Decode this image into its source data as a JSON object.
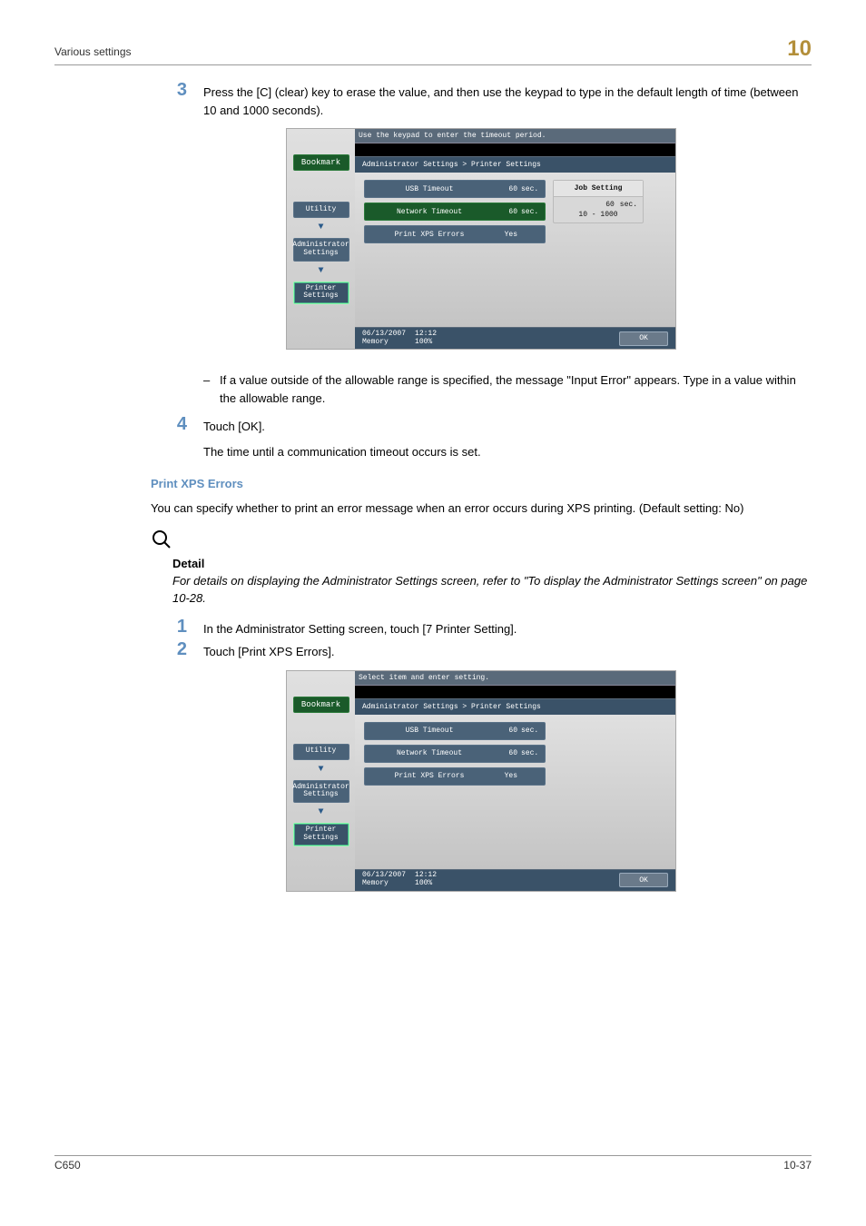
{
  "header": {
    "title": "Various settings",
    "chapter": "10"
  },
  "step3": {
    "num": "3",
    "text": "Press the [C] (clear) key to erase the value, and then use the keypad to type in the default length of time (between 10 and 1000 seconds).",
    "bullet": "If a value outside of the allowable range is specified, the message \"Input Error\" appears. Type in a value within the allowable range."
  },
  "step4": {
    "num": "4",
    "text1": "Touch [OK].",
    "text2": "The time until a communication timeout occurs is set."
  },
  "xps": {
    "title": "Print XPS Errors",
    "body": "You can specify whether to print an error message when an error occurs during XPS printing. (Default setting: No)",
    "detail_label": "Detail",
    "detail_text": "For details on displaying the Administrator Settings screen, refer to \"To display the Administrator Settings screen\" on page 10-28."
  },
  "step1b": {
    "num": "1",
    "text": "In the Administrator Setting screen, touch [7 Printer Setting]."
  },
  "step2b": {
    "num": "2",
    "text": "Touch [Print XPS Errors]."
  },
  "footer": {
    "model": "C650",
    "pagenum": "10-37"
  },
  "panelA": {
    "topmsg": "Use the keypad to enter the timeout period.",
    "crumb": "Administrator Settings > Printer Settings",
    "bookmark": "Bookmark",
    "utility": "Utility",
    "admin": "Administrator\nSettings",
    "printer": "Printer Settings",
    "opts": [
      {
        "label": "USB Timeout",
        "val": "60",
        "unit": "sec."
      },
      {
        "label": "Network Timeout",
        "val": "60",
        "unit": "sec."
      },
      {
        "label": "Print XPS Errors",
        "val": "Yes",
        "unit": ""
      }
    ],
    "jobbox": {
      "title": "Job Setting",
      "val": "60",
      "unit": "sec.",
      "range": "10  -  1000"
    },
    "date": "06/13/2007",
    "time": "12:12",
    "mem": "Memory",
    "mempct": "100%",
    "ok": "OK"
  },
  "panelB": {
    "topmsg": "Select item and enter setting.",
    "crumb": "Administrator Settings > Printer Settings",
    "bookmark": "Bookmark",
    "utility": "Utility",
    "admin": "Administrator\nSettings",
    "printer": "Printer Settings",
    "opts": [
      {
        "label": "USB Timeout",
        "val": "60",
        "unit": "sec."
      },
      {
        "label": "Network Timeout",
        "val": "60",
        "unit": "sec."
      },
      {
        "label": "Print XPS Errors",
        "val": "Yes",
        "unit": ""
      }
    ],
    "date": "06/13/2007",
    "time": "12:12",
    "mem": "Memory",
    "mempct": "100%",
    "ok": "OK"
  }
}
